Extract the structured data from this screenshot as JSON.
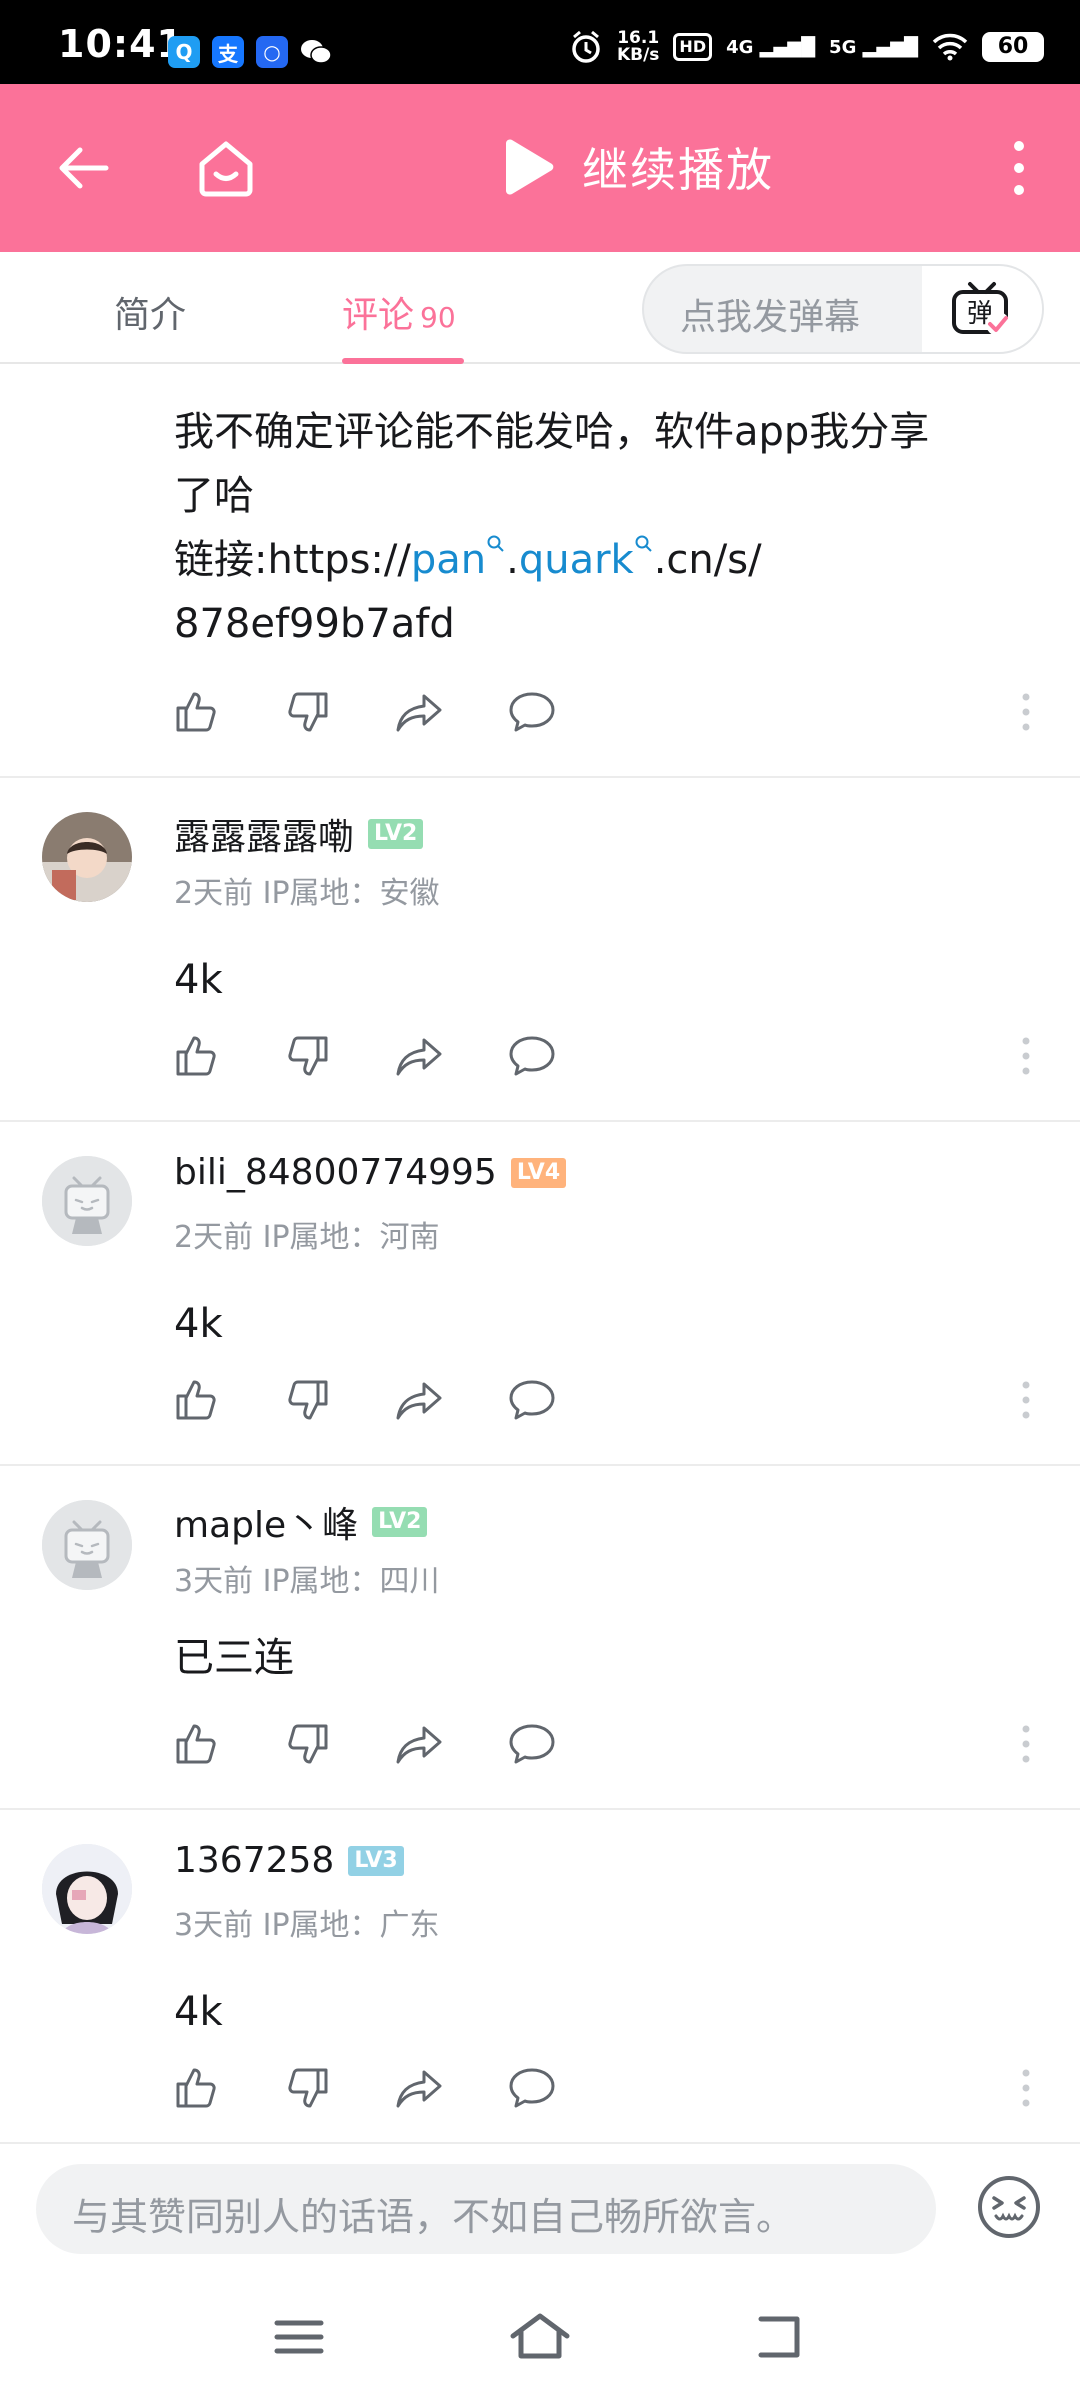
{
  "status_bar": {
    "time": "10:41",
    "net_speed_value": "16.1",
    "net_speed_unit": "KB/s",
    "hd": "HD",
    "signal_4g": "4G",
    "signal_5g": "5G",
    "battery": "60"
  },
  "header": {
    "title": "继续播放",
    "accent_color": "#fb7299"
  },
  "tabs": {
    "intro": "简介",
    "comments": "评论",
    "comments_count": "90",
    "danmaku_placeholder": "点我发弹幕",
    "danmaku_toggle": "弹"
  },
  "comments": [
    {
      "text_lines": [
        "我不确定评论能不能发哈，软件app我分享",
        "了哈"
      ],
      "link_prefix": "链接:https://",
      "link_pan": "pan",
      "link_dot": ".",
      "link_quark": "quark",
      "link_suffix": ".cn/s/",
      "link_last": "878ef99b7afd"
    },
    {
      "user": "露露露露嘞",
      "level": "LV2",
      "meta": "2天前 IP属地：安徽",
      "text": "4k"
    },
    {
      "user": "bili_84800774995",
      "level": "LV4",
      "meta": "2天前 IP属地：河南",
      "text": "4k"
    },
    {
      "user": "maple丶峰",
      "level": "LV2",
      "meta": "3天前 IP属地：四川",
      "text": "已三连"
    },
    {
      "user": "1367258",
      "level": "LV3",
      "meta": "3天前 IP属地：广东",
      "text": "4k"
    }
  ],
  "level_colors": {
    "LV2": "#95ddb2",
    "LV3": "#92d1e5",
    "LV4": "#ffb37c"
  },
  "input": {
    "placeholder": "与其赞同别人的话语，不如自己畅所欲言。"
  }
}
